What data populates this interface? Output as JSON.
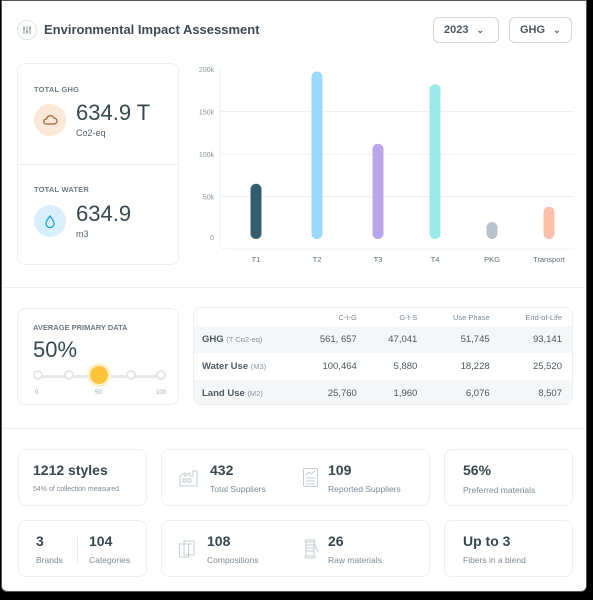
{
  "header": {
    "title": "Environmental Impact Assessment",
    "icon": "sliders-icon",
    "year_dropdown": "2023",
    "metric_dropdown": "GHG"
  },
  "totals": {
    "ghg": {
      "label": "TOTAL GHG",
      "value": "634.9 T",
      "unit": "Co2-eq",
      "icon": "cloud-icon"
    },
    "water": {
      "label": "TOTAL WATER",
      "value": "634.9",
      "unit": "m3",
      "icon": "water-drop-icon"
    }
  },
  "chart_data": {
    "type": "bar",
    "title": "",
    "xlabel": "",
    "ylabel": "",
    "categories": [
      "T1",
      "T2",
      "T3",
      "T4",
      "PKG",
      "Transport"
    ],
    "values": [
      65000,
      197000,
      112000,
      182000,
      20000,
      38000
    ],
    "colors": [
      "#345d6e",
      "#9ad9fb",
      "#b9a6eb",
      "#9beaea",
      "#b8c2c8",
      "#fdbfa9"
    ],
    "yticks": [
      "0",
      "50k",
      "100k",
      "150k",
      "200k"
    ],
    "ylim": [
      0,
      200000
    ],
    "grid": true,
    "legend": "none"
  },
  "avg_primary": {
    "label": "AVERAGE PRIMARY DATA",
    "value": "50%",
    "slider_value": 50,
    "ticks": [
      "0",
      "50",
      "100"
    ]
  },
  "table": {
    "columns": [
      "",
      "C-t-G",
      "G-t-S",
      "Use Phase",
      "End-of-Life"
    ],
    "rows": [
      {
        "name": "GHG",
        "unit": "(T Co2-eq)",
        "values": [
          "561, 657",
          "47,041",
          "51,745",
          "93,141"
        ]
      },
      {
        "name": "Water Use",
        "unit": "(M3)",
        "values": [
          "100,464",
          "5,880",
          "18,228",
          "25,520"
        ]
      },
      {
        "name": "Land Use",
        "unit": "(M2)",
        "values": [
          "25,760",
          "1,960",
          "6,076",
          "8,507"
        ]
      }
    ]
  },
  "stats": {
    "styles": {
      "value": "1212 styles",
      "sub": "54% of collection measured"
    },
    "total_suppliers": {
      "value": "432",
      "sub": "Total Suppliers",
      "icon": "factory-icon"
    },
    "reported_suppliers": {
      "value": "109",
      "sub": "Reported Suppliers",
      "icon": "report-icon"
    },
    "preferred": {
      "value": "56%",
      "sub": "Preferred materials"
    },
    "brands": {
      "value": "3",
      "sub": "Brands"
    },
    "categories": {
      "value": "104",
      "sub": "Categories"
    },
    "compositions": {
      "value": "108",
      "sub": "Compositions",
      "icon": "layers-icon"
    },
    "raw_materials": {
      "value": "26",
      "sub": "Raw materials",
      "icon": "thread-spool-icon"
    },
    "fibers": {
      "value": "Up to 3",
      "sub": "Fibers in a blend"
    }
  }
}
